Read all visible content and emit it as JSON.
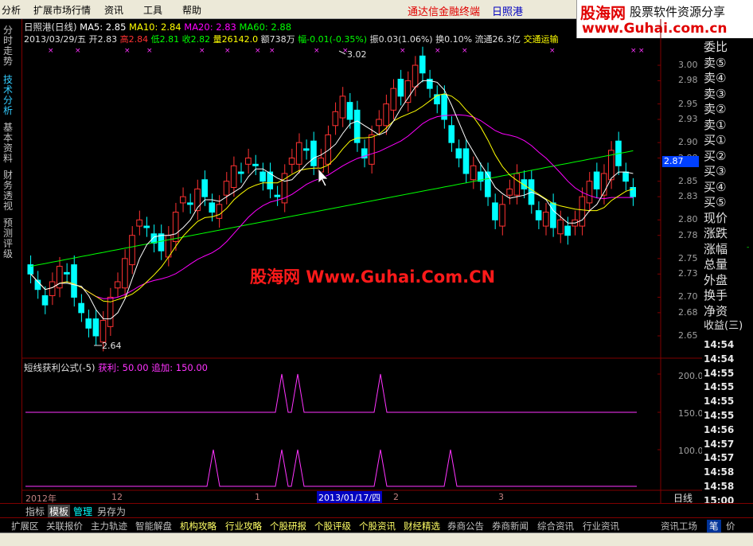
{
  "menu": {
    "items": [
      "分析",
      "扩展市场行情",
      "资讯",
      "工具",
      "帮助"
    ],
    "right_app": "通达信金融终端",
    "right_stock": "日照港"
  },
  "logo": {
    "brand": "股海网",
    "slogan": "股票软件资源分享",
    "url": "www.Guhai.com.cn"
  },
  "left_tabs": [
    "分时走势",
    "技术分析",
    "基本资料",
    "财务透视",
    "预测评级"
  ],
  "info": {
    "line1_title": "日照港(日线)",
    "ma5": "MA5: 2.85",
    "ma10": "MA10: 2.84",
    "ma20": "MA20: 2.83",
    "ma60": "MA60: 2.88",
    "date": "2013/03/29/五",
    "open": "开2.83",
    "high": "高2.84",
    "low": "低2.81",
    "close": "收2.82",
    "vol": "量26142.0",
    "amount": "额738万",
    "change": "幅-0.01(-0.35%)",
    "amplitude": "振0.03(1.06%)",
    "turnover": "换0.10%",
    "float": "流通26.3亿",
    "sector": "交通运输"
  },
  "price_axis": [
    "3.00",
    "2.98",
    "2.95",
    "2.93",
    "2.90",
    "2.88",
    "2.85",
    "2.83",
    "2.80",
    "2.78",
    "2.75",
    "2.73",
    "2.70",
    "2.68",
    "2.65"
  ],
  "current_price_tag": "2.87",
  "annotations": {
    "high_mark": "3.02",
    "low_mark": "2.64"
  },
  "watermark": "股海网 Www.Guhai.Com.CN",
  "indicator": {
    "title": "短线获利公式(-5)",
    "v1": "获利: 50.00",
    "v2": "追加: 150.00",
    "axis": [
      "200.0",
      "150.0",
      "100.0"
    ]
  },
  "date_axis": {
    "year": "2012年",
    "m12": "12",
    "m1": "1",
    "cursor": "2013/01/17/四",
    "m2": "2",
    "m3": "3",
    "period": "日线"
  },
  "right_panel": {
    "labels": [
      "委比",
      "卖⑤",
      "卖④",
      "卖③",
      "卖②",
      "卖①",
      "买①",
      "买②",
      "买③",
      "买④",
      "买⑤",
      "现价",
      "涨跌",
      "涨幅",
      "总量",
      "外盘",
      "换手",
      "净资",
      "收益(三)"
    ],
    "times": [
      "14:54",
      "14:54",
      "14:55",
      "14:55",
      "14:55",
      "14:55",
      "14:56",
      "14:57",
      "14:57",
      "14:58",
      "14:58",
      "15:00"
    ]
  },
  "bottom_tabs": [
    "指标",
    "模板",
    "管理",
    "另存为"
  ],
  "bottom_bar": [
    "扩展区",
    "关联报价",
    "主力轨迹",
    "智能解盘",
    "机构攻略",
    "行业攻略",
    "个股研报",
    "个股评级",
    "个股资讯",
    "财经精选",
    "券商公告",
    "券商新闻",
    "综合资讯",
    "行业资讯",
    "资讯工场",
    "笔",
    "价"
  ],
  "colors": {
    "up": "#ff3232",
    "down": "#00ffff",
    "ma5": "#ffffff",
    "ma10": "#ffff00",
    "ma20": "#ff00ff",
    "ma60": "#00ff00",
    "grid": "#800000"
  }
}
